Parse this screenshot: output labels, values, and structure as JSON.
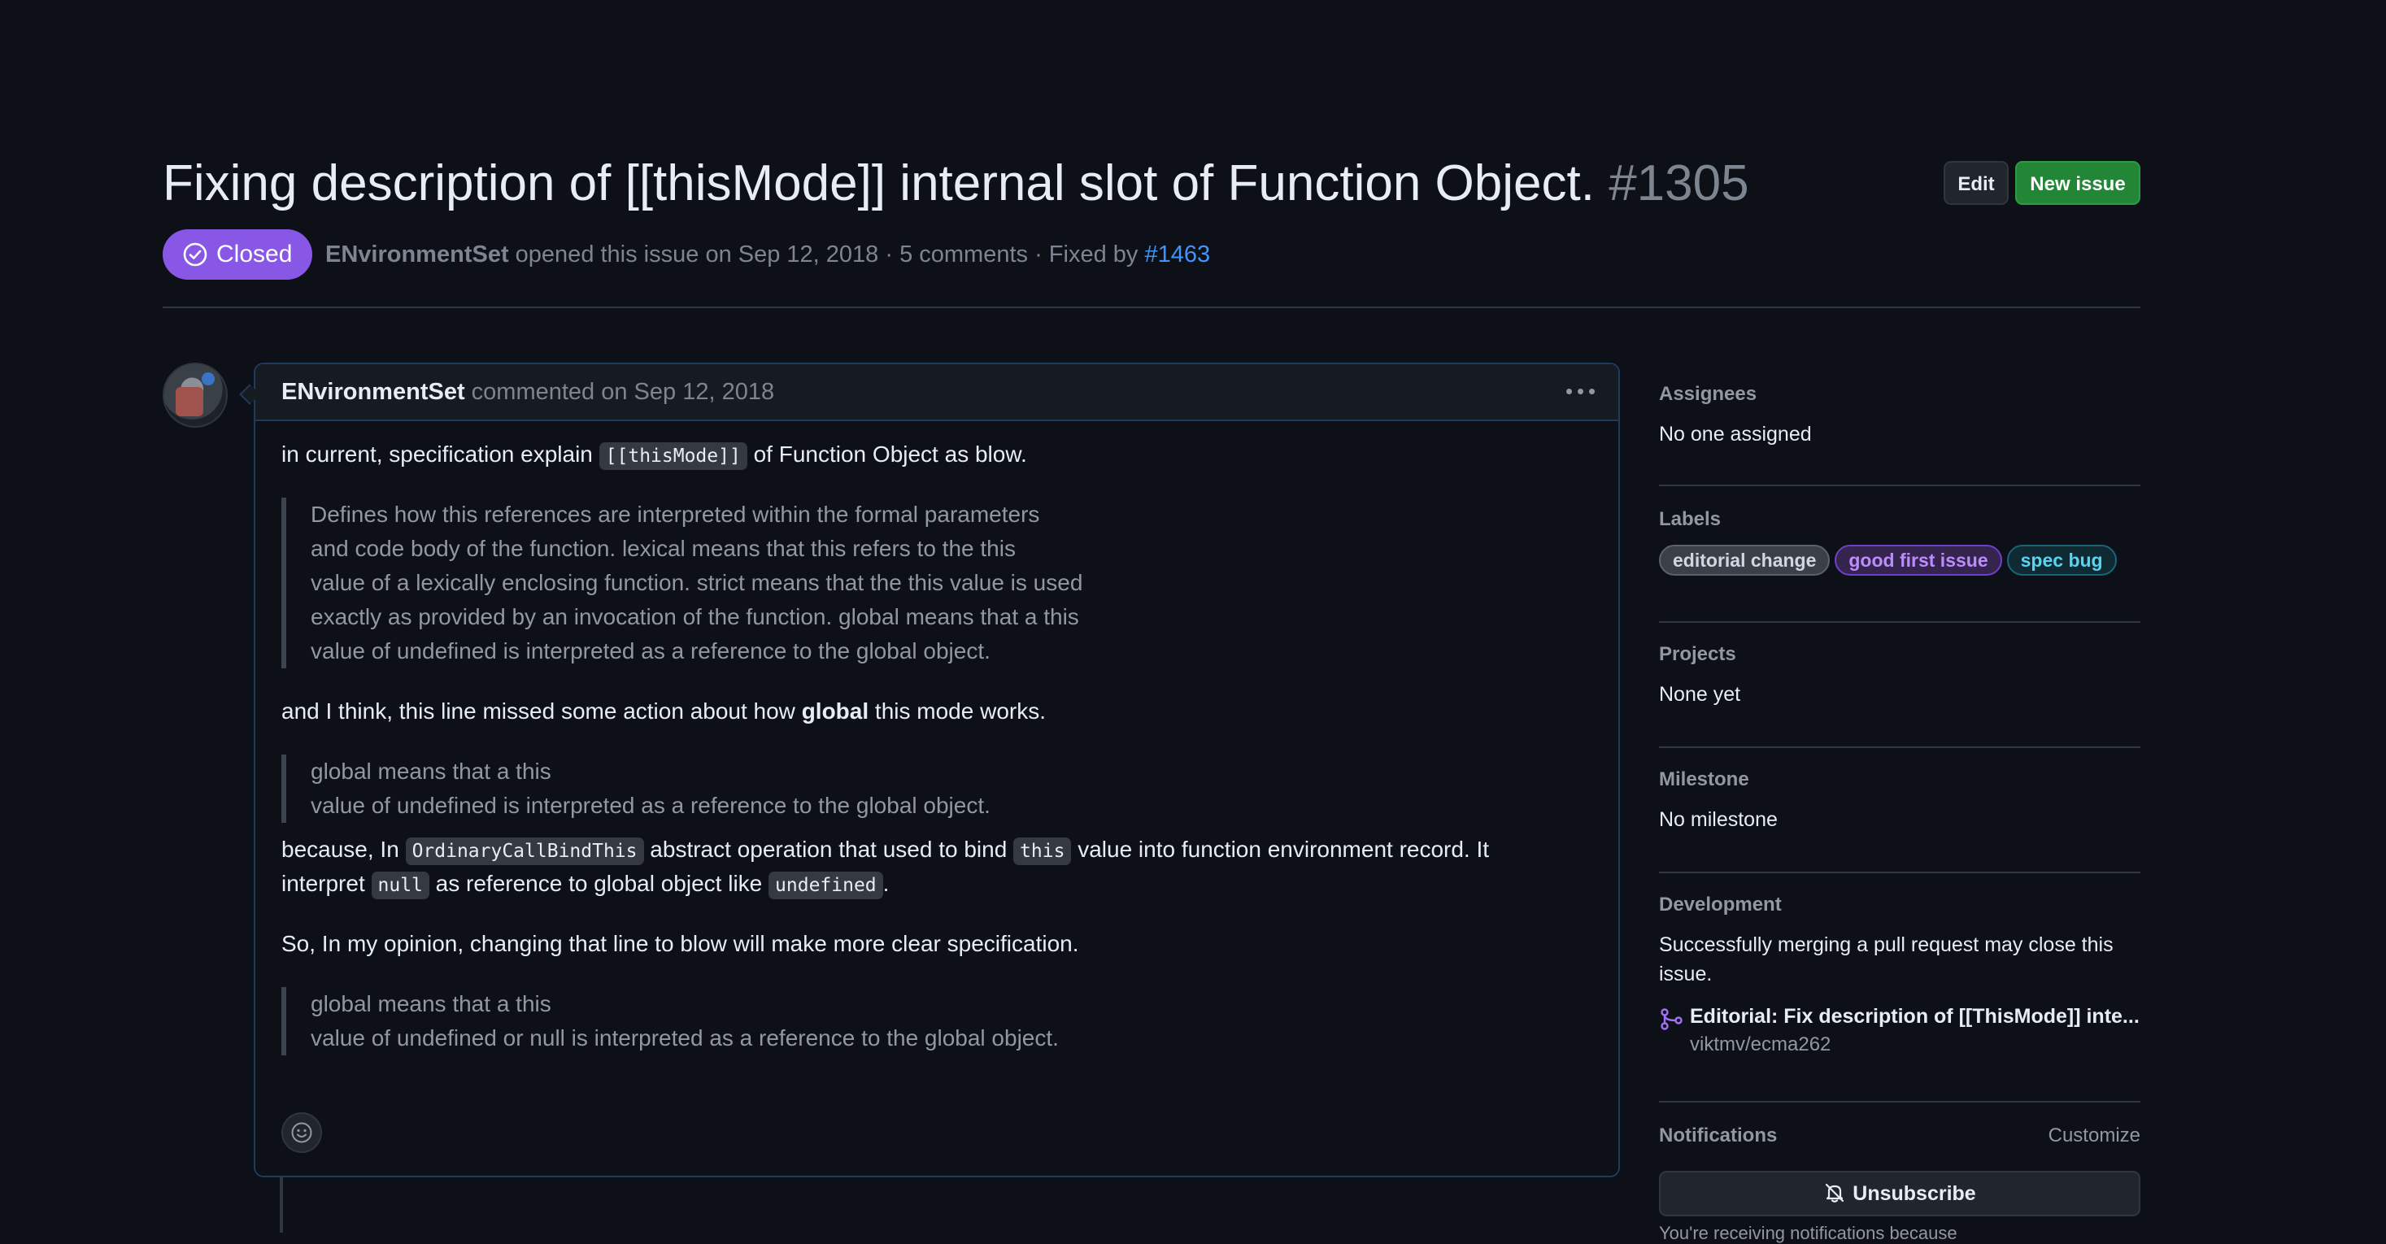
{
  "issue": {
    "title": "Fixing description of [[thisMode]] internal slot of Function Object.",
    "number": "#1305",
    "state": "Closed",
    "author": "ENvironmentSet",
    "opened_text": "opened this issue on Sep 12, 2018 · 5 comments · Fixed by",
    "fixed_by": "#1463"
  },
  "header_actions": {
    "edit_label": "Edit",
    "new_issue_label": "New issue"
  },
  "comment": {
    "author": "ENvironmentSet",
    "meta": "commented on Sep 12, 2018",
    "p1_before": "in current, specification explain",
    "p1_code": "[[thisMode]]",
    "p1_after": "of Function Object as blow.",
    "quote1": [
      "Defines how this references are interpreted within the formal parameters",
      "and code body of the function. lexical means that this refers to the this",
      "value of a lexically enclosing function. strict means that the this value is used",
      "exactly as provided by an invocation of the function. global means that a this",
      "value of undefined is interpreted as a reference to the global object."
    ],
    "p2_before": "and I think, this line missed some action about how",
    "p2_bold": "global",
    "p2_after": "this mode works.",
    "quote2": [
      "global means that a this",
      "value of undefined is interpreted as a reference to the global object."
    ],
    "p3_a": "because, In",
    "p3_code1": "OrdinaryCallBindThis",
    "p3_b": "abstract operation that used to bind",
    "p3_code2": "this",
    "p3_c": "value into function environment record. It",
    "p3_d": "interpret",
    "p3_code3": "null",
    "p3_e": "as reference to global object like",
    "p3_code4": "undefined",
    "p3_f": ".",
    "p4": "So, In my opinion, changing that line to blow will make more clear specification.",
    "quote3": [
      "global means that a this",
      "value of undefined or null is interpreted as a reference to the global object."
    ]
  },
  "sidebar": {
    "assignees": {
      "heading": "Assignees",
      "value": "No one assigned"
    },
    "labels": {
      "heading": "Labels",
      "items": [
        "editorial change",
        "good first issue",
        "spec bug"
      ]
    },
    "projects": {
      "heading": "Projects",
      "value": "None yet"
    },
    "milestone": {
      "heading": "Milestone",
      "value": "No milestone"
    },
    "development": {
      "heading": "Development",
      "note_line1": "Successfully merging a pull request may close this",
      "note_line2": "issue.",
      "pr_title": "Editorial: Fix description of [[ThisMode]] inte...",
      "pr_repo": "viktmv/ecma262"
    },
    "notifications": {
      "heading": "Notifications",
      "customize": "Customize",
      "unsubscribe": "Unsubscribe",
      "note": "You're receiving notifications because"
    }
  },
  "colors": {
    "background": "#0d1117",
    "closed_badge": "#8957e5",
    "new_issue_button": "#238636",
    "link": "#4493f8",
    "comment_border": "#1f3a5f"
  },
  "icons": {
    "state": "check-circle-icon",
    "kebab": "kebab-horizontal-icon",
    "reaction": "smiley-icon",
    "pull_request": "git-pull-request-icon",
    "unsubscribe": "bell-slash-icon"
  }
}
